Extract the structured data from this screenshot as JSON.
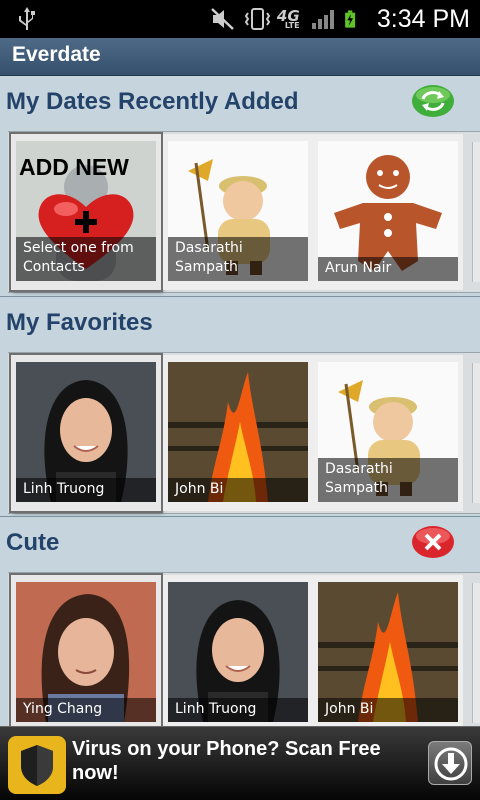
{
  "status_bar": {
    "time": "3:34 PM",
    "icons": [
      "usb-icon",
      "mute-icon",
      "vibrate-icon",
      "4g-lte-icon",
      "signal-icon",
      "battery-charging-icon"
    ],
    "network_label": "4G",
    "network_sub": "LTE"
  },
  "app": {
    "title": "Everdate"
  },
  "sections": [
    {
      "title": "My Dates Recently Added",
      "action_icon": "refresh-icon",
      "cards": [
        {
          "banner": "ADD NEW",
          "caption": "Select one from Contacts",
          "image": "add-new-heart",
          "selected": true
        },
        {
          "caption": "Dasarathi Sampath",
          "image": "scout-cartoon"
        },
        {
          "caption": "Arun Nair",
          "image": "gingerbread-man"
        }
      ]
    },
    {
      "title": "My Favorites",
      "cards": [
        {
          "caption": "Linh Truong",
          "image": "portrait-woman",
          "selected": true
        },
        {
          "caption": "John Bi",
          "image": "bonfire"
        },
        {
          "caption": "Dasarathi Sampath",
          "image": "scout-cartoon"
        }
      ]
    },
    {
      "title": "Cute",
      "action_icon": "delete-icon",
      "cards": [
        {
          "caption": "Ying Chang",
          "image": "portrait-woman-2",
          "selected": true
        },
        {
          "caption": "Linh Truong",
          "image": "portrait-woman"
        },
        {
          "caption": "John Bi",
          "image": "bonfire"
        }
      ]
    }
  ],
  "ad": {
    "text": "Virus on your Phone? Scan Free now!",
    "icon": "shield-icon",
    "action_icon": "download-icon"
  },
  "colors": {
    "title_bar": "#3f5a77",
    "content_bg": "#c6d4dd",
    "section_title": "#24436a",
    "refresh_green": "#3fae3a",
    "delete_red": "#d9252b",
    "ad_icon": "#e8b51c"
  }
}
